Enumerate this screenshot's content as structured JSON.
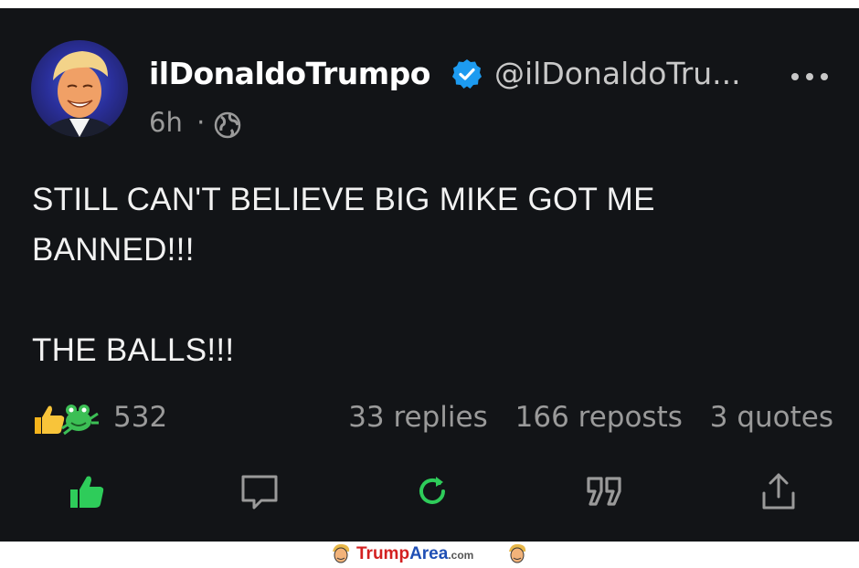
{
  "post": {
    "author": {
      "display_name": "ilDonaldoTrumpo",
      "handle": "@ilDonaldoTru...",
      "verified": true,
      "avatar_icon": "avatar"
    },
    "time": "6h",
    "separator": "·",
    "visibility_icon": "globe-icon",
    "text_lines": [
      "STILL CAN'T BELIEVE BIG MIKE GOT ME",
      "BANNED!!!",
      "THE BALLS!!!"
    ],
    "reactions": {
      "icons": [
        "thumbs-up-icon",
        "frog-icon"
      ],
      "count": "532"
    },
    "stats": {
      "replies": "33 replies",
      "reposts": "166 reposts",
      "quotes": "3 quotes"
    },
    "actions": [
      "like-button",
      "reply-button",
      "repost-button",
      "quote-button",
      "share-button"
    ]
  },
  "colors": {
    "background": "#121417",
    "like_active": "#2ecc5a",
    "repost_active": "#2ecc5a",
    "verified": "#1d9bf0"
  },
  "watermark": {
    "brand_red": "Trump",
    "brand_blue": "Area",
    "suffix": ".com"
  }
}
